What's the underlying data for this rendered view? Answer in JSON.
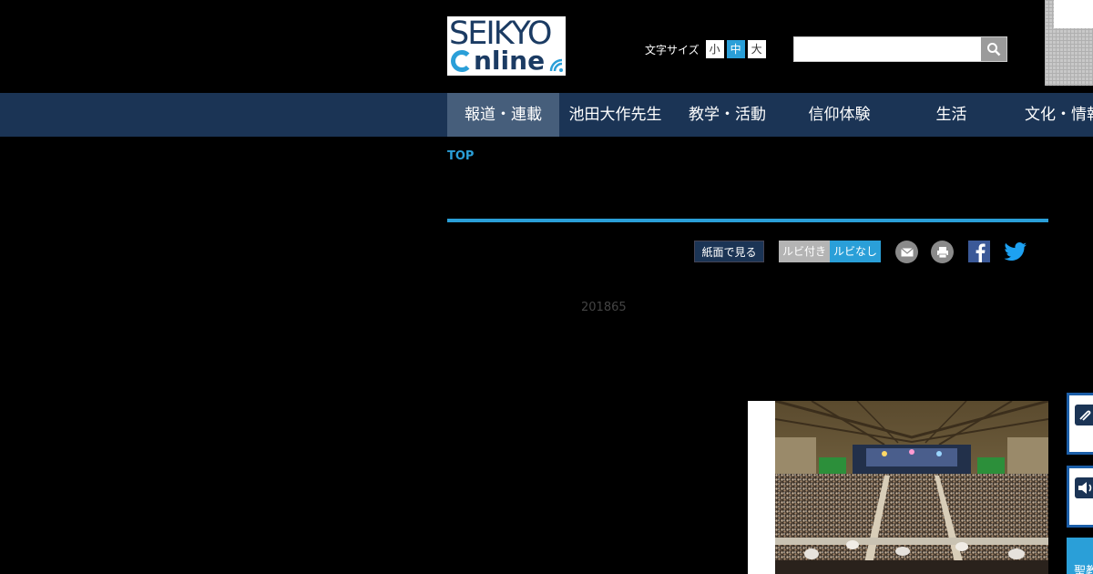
{
  "logo": {
    "line1": "SEIKYO",
    "line2_rest": "nline"
  },
  "font_size": {
    "label": "文字サイズ",
    "small": "小",
    "medium": "中",
    "large": "大"
  },
  "search": {
    "placeholder": ""
  },
  "nav": {
    "items": [
      {
        "label": "報道・連載"
      },
      {
        "label": "池田大作先生"
      },
      {
        "label": "教学・活動"
      },
      {
        "label": "信仰体験"
      },
      {
        "label": "生活"
      },
      {
        "label": "文化・情報"
      }
    ]
  },
  "breadcrumb": {
    "top": "TOP"
  },
  "tools": {
    "paper_label": "紙面で見る",
    "ruby_on": "ルビ付き",
    "ruby_off": "ルビなし"
  },
  "article": {
    "date": "201865"
  },
  "side": {
    "label3": "聖教"
  },
  "colors": {
    "accent": "#2a9fd8",
    "nav_bg": "#1b3455",
    "nav_active": "#465e7b"
  }
}
